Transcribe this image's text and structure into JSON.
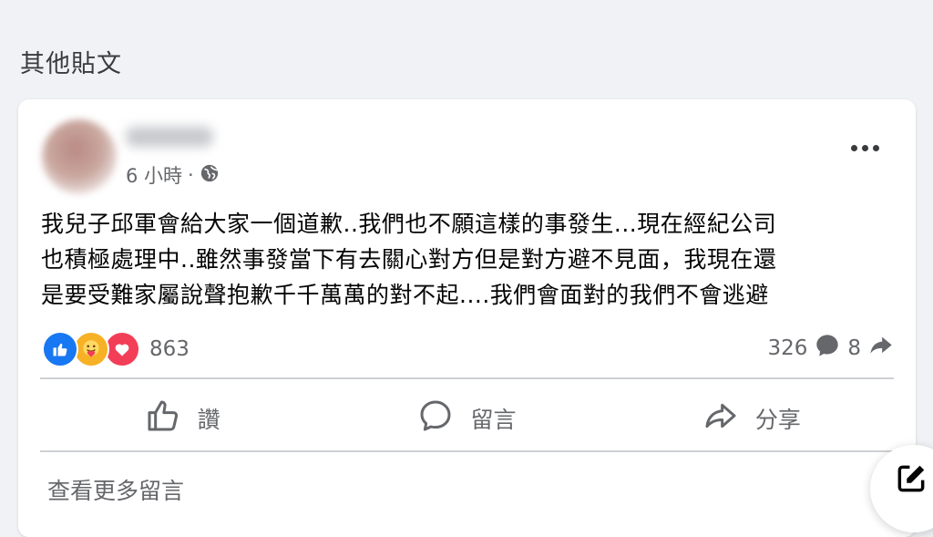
{
  "section_title": "其他貼文",
  "post": {
    "time": "6 小時",
    "separator": "·",
    "text_lines": [
      "我兒子邱軍會給大家一個道歉..我們也不願這樣的事發生...現在經紀公司",
      "也積極處理中..雖然事發當下有去關心對方但是對方避不見面，我現在還",
      "是要受難家屬說聲抱歉千千萬萬的對不起....我們會面對的我們不會逃避"
    ],
    "reaction_icons": [
      "like-icon",
      "care-icon",
      "love-icon"
    ],
    "reaction_count": "863",
    "comment_count": "326",
    "share_count": "8"
  },
  "actions": {
    "like": "讚",
    "comment": "留言",
    "share": "分享"
  },
  "more_comments": "查看更多留言",
  "colors": {
    "background": "#f0f2f5",
    "like_blue": "#1877f2",
    "love_red": "#f33e58",
    "care_yellow": "#f7b125",
    "secondary_text": "#65676b"
  }
}
